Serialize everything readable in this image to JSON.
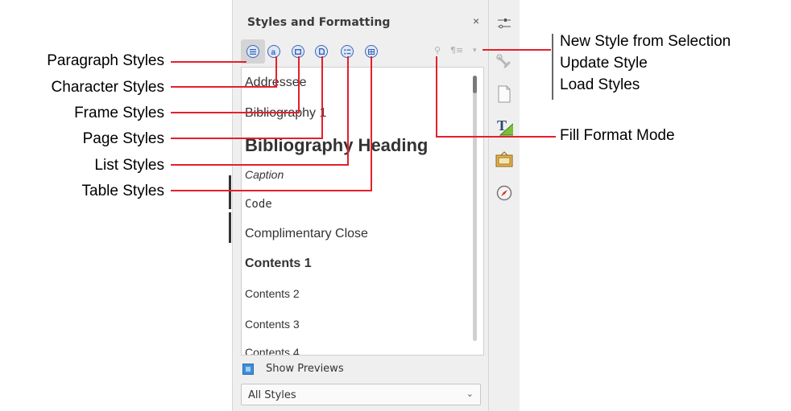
{
  "panel": {
    "title": "Styles and Formatting",
    "close_label": "×",
    "toolbar": {
      "buttons": [
        {
          "name": "paragraph-styles-icon"
        },
        {
          "name": "character-styles-icon"
        },
        {
          "name": "frame-styles-icon"
        },
        {
          "name": "page-styles-icon"
        },
        {
          "name": "list-styles-icon"
        },
        {
          "name": "table-styles-icon"
        }
      ],
      "fill_format_glyph": "⚲",
      "new_style_glyph": "¶≡",
      "dropdown_glyph": "▾"
    },
    "styles": [
      {
        "label": "Addressee"
      },
      {
        "label": "Bibliography 1"
      },
      {
        "label": "Bibliography Heading"
      },
      {
        "label": "Caption"
      },
      {
        "label": "Code"
      },
      {
        "label": "Complimentary Close"
      },
      {
        "label": "Contents 1"
      },
      {
        "label": "Contents 2"
      },
      {
        "label": "Contents 3"
      },
      {
        "label": "Contents 4"
      }
    ],
    "show_previews": {
      "label": "Show Previews",
      "checked": true
    },
    "filter": {
      "value": "All Styles",
      "chevron": "⌄"
    }
  },
  "deck": {
    "icons": [
      "properties-icon",
      "wrench-icon",
      "page-icon",
      "styles-icon",
      "gallery-icon",
      "navigator-icon"
    ]
  },
  "callouts": {
    "left": [
      "Paragraph Styles",
      "Character Styles",
      "Frame Styles",
      "Page Styles",
      "List Styles",
      "Table Styles"
    ],
    "right_group": [
      "New Style from Selection",
      "Update Style",
      "Load Styles"
    ],
    "fill_format": "Fill Format Mode"
  },
  "colors": {
    "accent": "#3b66b5",
    "callout_line": "#e4202a",
    "checkbox": "#3d8fd8"
  }
}
